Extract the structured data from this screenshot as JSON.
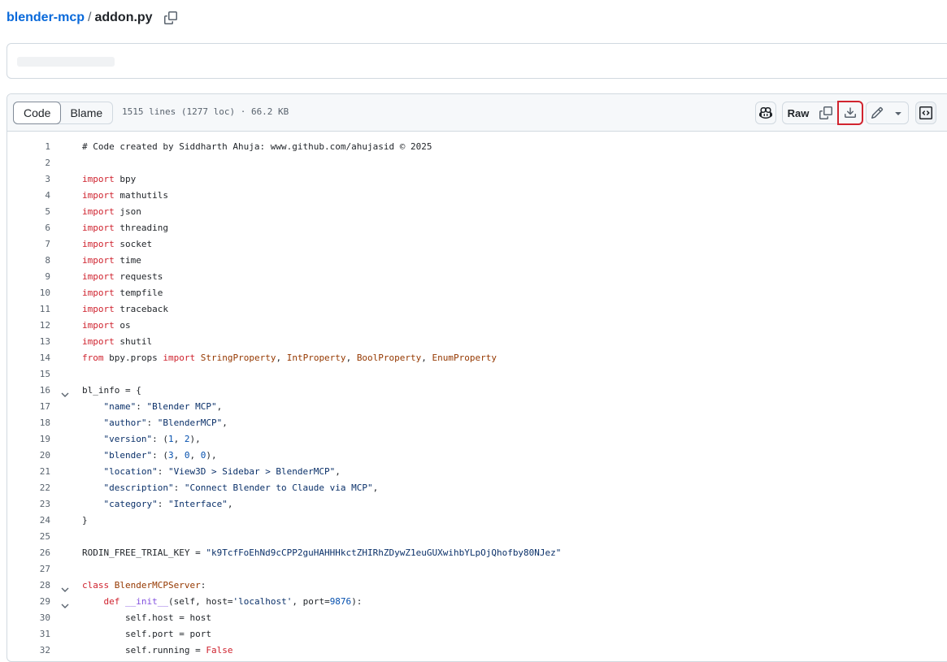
{
  "breadcrumb": {
    "repo": "blender-mcp",
    "separator": "/",
    "file": "addon.py",
    "copy_icon": "copy-icon"
  },
  "file_header": {
    "tabs": [
      {
        "label": "Code",
        "active": true
      },
      {
        "label": "Blame",
        "active": false
      }
    ],
    "info": "1515 lines (1277 loc) · 66.2 KB",
    "buttons": {
      "copilot_icon": "copilot-icon",
      "raw_label": "Raw",
      "copy_icon": "copy-icon",
      "download_icon": "download-icon",
      "edit_icon": "pencil-icon",
      "more_icon": "triangle-down-icon",
      "symbols_icon": "code-square-icon"
    },
    "highlight_color": "#d1242f"
  },
  "code": {
    "lines": [
      {
        "n": "1",
        "t": "# Code created by Siddharth Ahuja: www.github.com/ahujasid © 2025"
      },
      {
        "n": "2",
        "t": ""
      },
      {
        "n": "3",
        "t": "import bpy"
      },
      {
        "n": "4",
        "t": "import mathutils"
      },
      {
        "n": "5",
        "t": "import json"
      },
      {
        "n": "6",
        "t": "import threading"
      },
      {
        "n": "7",
        "t": "import socket"
      },
      {
        "n": "8",
        "t": "import time"
      },
      {
        "n": "9",
        "t": "import requests"
      },
      {
        "n": "10",
        "t": "import tempfile"
      },
      {
        "n": "11",
        "t": "import traceback"
      },
      {
        "n": "12",
        "t": "import os"
      },
      {
        "n": "13",
        "t": "import shutil"
      },
      {
        "n": "14",
        "t": "from bpy.props import StringProperty, IntProperty, BoolProperty, EnumProperty"
      },
      {
        "n": "15",
        "t": ""
      },
      {
        "n": "16",
        "t": "bl_info = {",
        "fold": true
      },
      {
        "n": "17",
        "t": "    \"name\": \"Blender MCP\","
      },
      {
        "n": "18",
        "t": "    \"author\": \"BlenderMCP\","
      },
      {
        "n": "19",
        "t": "    \"version\": (1, 2),"
      },
      {
        "n": "20",
        "t": "    \"blender\": (3, 0, 0),"
      },
      {
        "n": "21",
        "t": "    \"location\": \"View3D > Sidebar > BlenderMCP\","
      },
      {
        "n": "22",
        "t": "    \"description\": \"Connect Blender to Claude via MCP\","
      },
      {
        "n": "23",
        "t": "    \"category\": \"Interface\","
      },
      {
        "n": "24",
        "t": "}"
      },
      {
        "n": "25",
        "t": ""
      },
      {
        "n": "26",
        "t": "RODIN_FREE_TRIAL_KEY = \"k9TcfFoEhNd9cCPP2guHAHHHkctZHIRhZDywZ1euGUXwihbYLpOjQhofby80NJez\""
      },
      {
        "n": "27",
        "t": ""
      },
      {
        "n": "28",
        "t": "class BlenderMCPServer:",
        "fold": true
      },
      {
        "n": "29",
        "t": "    def __init__(self, host='localhost', port=9876):",
        "fold": true
      },
      {
        "n": "30",
        "t": "        self.host = host"
      },
      {
        "n": "31",
        "t": "        self.port = port"
      },
      {
        "n": "32",
        "t": "        self.running = False"
      }
    ]
  },
  "colors": {
    "keyword": "#cf222e",
    "string": "#0a3069",
    "number": "#0550ae",
    "function": "#8250df",
    "class": "#953800",
    "link": "#0969da"
  }
}
